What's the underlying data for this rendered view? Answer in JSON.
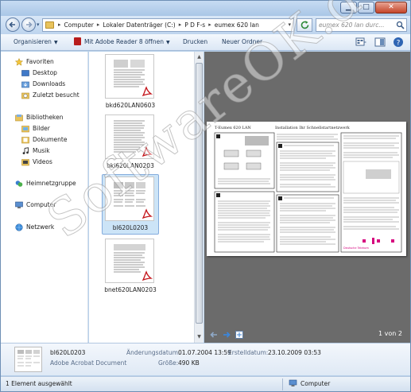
{
  "window": {
    "minimize_glyph": "▁",
    "maximize_glyph": "□",
    "close_glyph": "✕"
  },
  "address": {
    "crumbs": [
      "Computer",
      "Lokaler Datenträger (C:)",
      "P D F-s",
      "eumex 620 lan"
    ],
    "separator": "▸",
    "search_placeholder": "eumex 620 lan durc..."
  },
  "toolbar": {
    "organize": "Organisieren",
    "open_with": "Mit Adobe Reader 8 öffnen",
    "print": "Drucken",
    "new_folder": "Neuer Ordner"
  },
  "nav": {
    "favorites": "Favoriten",
    "desktop": "Desktop",
    "downloads": "Downloads",
    "recent": "Zuletzt besucht",
    "libraries": "Bibliotheken",
    "pictures": "Bilder",
    "documents": "Dokumente",
    "music": "Musik",
    "videos": "Videos",
    "homegroup": "Heimnetzgruppe",
    "computer": "Computer",
    "network": "Netzwerk"
  },
  "files": [
    {
      "name": "bkd620LAN0603"
    },
    {
      "name": "bki620LAN0203"
    },
    {
      "name": "bl620L0203"
    },
    {
      "name": "bnet620LAN0203"
    }
  ],
  "preview": {
    "doc_title_left": "T-Eumex 620 LAN",
    "doc_title_right": "Installation Ihr Schnellstartnetzwerk",
    "page_count": "1 von 2",
    "logo_text": "Deutsche Telekom"
  },
  "details": {
    "name": "bl620L0203",
    "type": "Adobe Acrobat Document",
    "modified_label": "Änderungsdatum:",
    "modified_value": "01.07.2004 13:59",
    "size_label": "Größe:",
    "size_value": "490 KB",
    "created_label": "Erstelldatum:",
    "created_value": "23.10.2009 03:53"
  },
  "status": {
    "selected": "1 Element ausgewählt",
    "location": "Computer"
  },
  "watermark": "SoftwareOK.de",
  "colors": {
    "accent": "#4a7fc1",
    "pdf_red": "#b81d1d",
    "preview_bg": "#6b6b6b"
  }
}
